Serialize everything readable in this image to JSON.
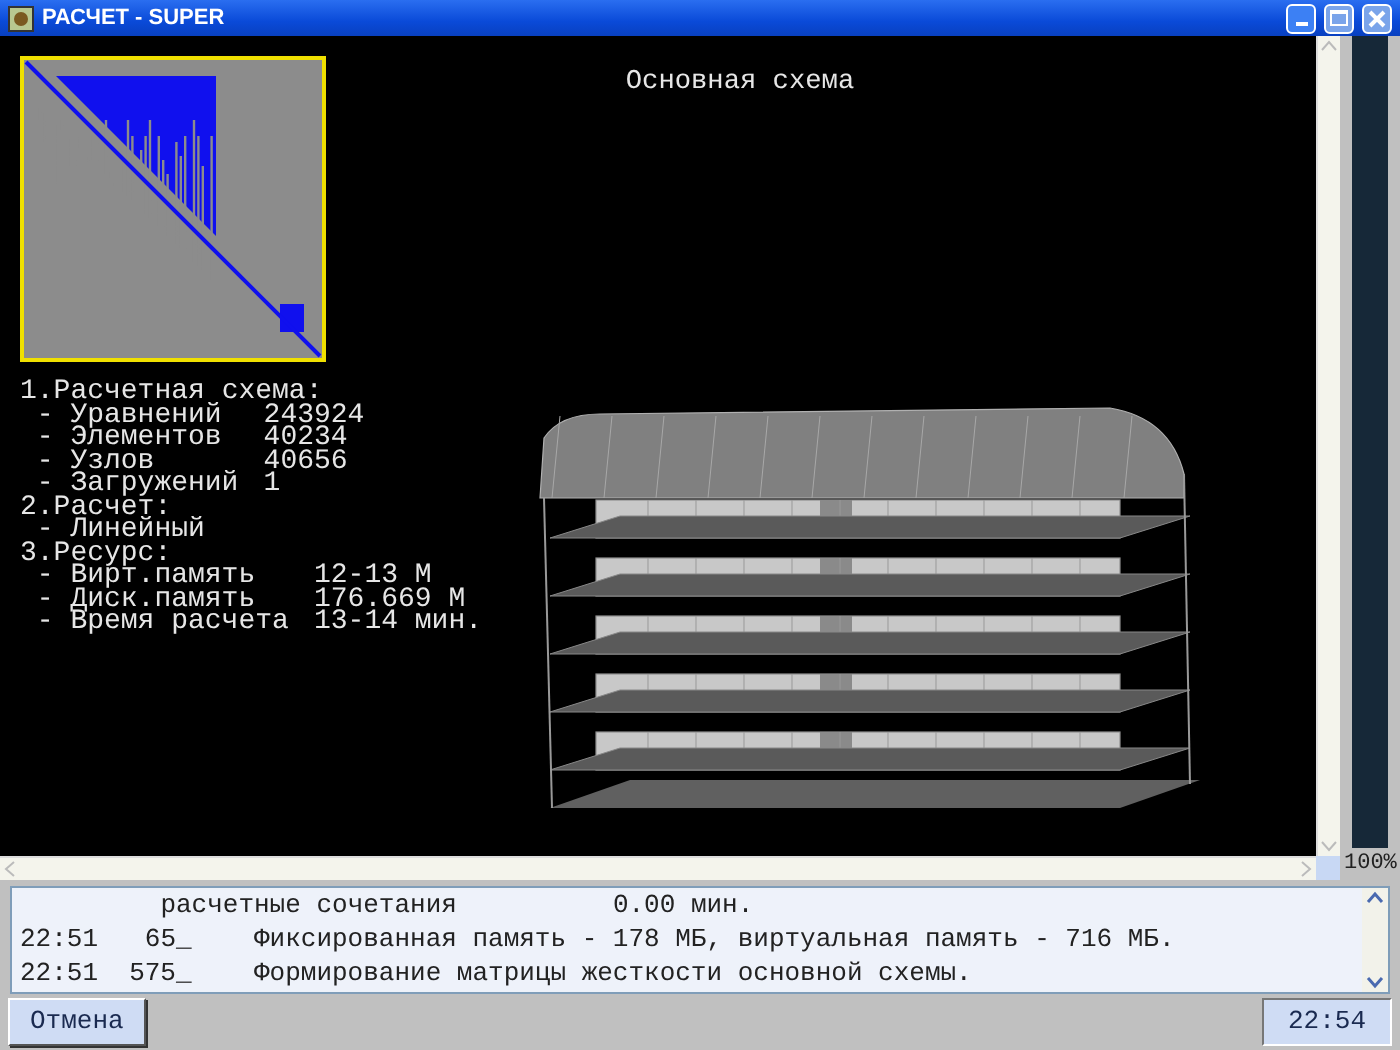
{
  "window": {
    "title": "РАСЧЕТ - SUPER"
  },
  "view": {
    "title": "Основная схема",
    "summary": [
      {
        "heading": "1.Расчетная схема:",
        "items": [
          {
            "label": "- Уравнений",
            "value": "243924"
          },
          {
            "label": "- Элементов",
            "value": "40234"
          },
          {
            "label": "- Узлов",
            "value": "40656"
          },
          {
            "label": "- Загружений",
            "value": "1"
          }
        ]
      },
      {
        "heading": "2.Расчет:",
        "items": [
          {
            "label": "- Линейный"
          }
        ]
      },
      {
        "heading": "3.Ресурс:",
        "items": [
          {
            "label": "- Вирт.память",
            "value": "12-13 М"
          },
          {
            "label": "- Диск.память",
            "value": "176.669 М"
          },
          {
            "label": "- Время расчета",
            "value": "13-14 мин."
          }
        ]
      }
    ]
  },
  "zoom": "100%",
  "log": [
    {
      "kind": "continuation",
      "message": "расчетные сочетания",
      "value": "0.00 мин."
    },
    {
      "kind": "entry",
      "time": "22:51",
      "count": "65_",
      "message": "Фиксированная память - 178 МБ, виртуальная память - 716 МБ."
    },
    {
      "kind": "entry",
      "time": "22:51",
      "count": "575_",
      "message": "Формирование матрицы жесткости основной схемы."
    }
  ],
  "cancel_button": "Отмена",
  "clock": "22:54"
}
